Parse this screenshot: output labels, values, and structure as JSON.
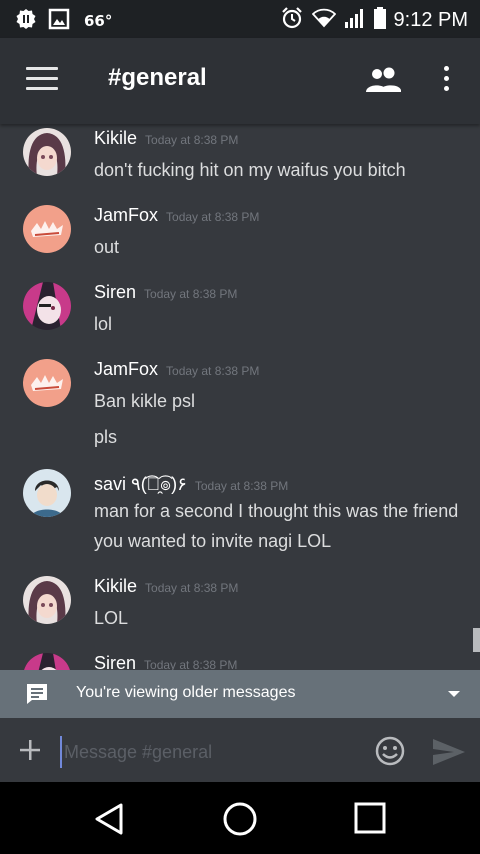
{
  "status_bar": {
    "temperature": "66°",
    "time": "9:12 PM",
    "icons": [
      "alarm-clock-icon",
      "wifi-icon",
      "signal-icon",
      "battery-icon"
    ]
  },
  "header": {
    "channel": "#general",
    "icons": [
      "menu-icon",
      "members-icon",
      "overflow-icon"
    ]
  },
  "messages": [
    {
      "author": "Kikile",
      "timestamp": "Today at 8:38 PM",
      "lines": [
        "don't fucking hit on my waifus  you bitch"
      ],
      "avatar_color": "#5a3a48"
    },
    {
      "author": "JamFox",
      "timestamp": "Today at 8:38 PM",
      "lines": [
        "out"
      ],
      "avatar_color": "#f2a08a"
    },
    {
      "author": "Siren",
      "timestamp": "Today at 8:38 PM",
      "lines": [
        "lol"
      ],
      "avatar_color": "#c83a8a"
    },
    {
      "author": "JamFox",
      "timestamp": "Today at 8:38 PM",
      "lines": [
        "Ban kikle psl",
        "pls"
      ],
      "avatar_color": "#f2a08a"
    },
    {
      "author": "savi ٩(͡๏̯͡๏)۶",
      "timestamp": "Today at 8:38 PM",
      "lines": [
        "man for a second I thought this was the friend you wanted to invite nagi LOL"
      ],
      "avatar_color": "#d9e6ee"
    },
    {
      "author": "Kikile",
      "timestamp": "Today at 8:38 PM",
      "lines": [
        "LOL"
      ],
      "avatar_color": "#5a3a48"
    },
    {
      "author": "Siren",
      "timestamp": "Today at 8:38 PM",
      "lines": [],
      "avatar_color": "#c83a8a"
    }
  ],
  "older_bar": {
    "text": "You're viewing older messages"
  },
  "composer": {
    "placeholder": "Message #general"
  },
  "colors": {
    "accent": "#7289da",
    "background": "#36393e",
    "header": "#2e3136",
    "status_bar": "#1e2124",
    "older_bar": "#677179"
  }
}
